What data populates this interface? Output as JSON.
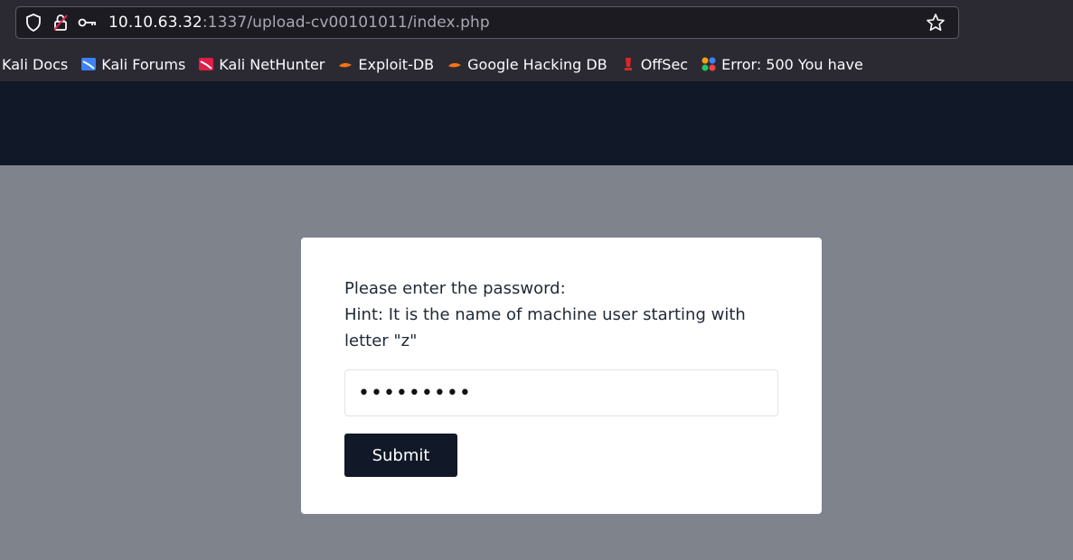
{
  "browser": {
    "url_host": "10.10.63.32",
    "url_path": ":1337/upload-cv00101011/index.php",
    "bookmarks": [
      {
        "label": "Kali Docs",
        "icon": "kali-docs-icon"
      },
      {
        "label": "Kali Forums",
        "icon": "kali-forums-icon"
      },
      {
        "label": "Kali NetHunter",
        "icon": "kali-nethunter-icon"
      },
      {
        "label": "Exploit-DB",
        "icon": "exploit-db-icon"
      },
      {
        "label": "Google Hacking DB",
        "icon": "ghdb-icon"
      },
      {
        "label": "OffSec",
        "icon": "offsec-icon"
      },
      {
        "label": "Error: 500 You have",
        "icon": "joomla-icon"
      }
    ]
  },
  "form": {
    "prompt_line1": "Please enter the password:",
    "prompt_line2": "Hint: It is the name of machine user starting with letter \"z\"",
    "password_value": "•••••••••",
    "submit_label": "Submit"
  },
  "colors": {
    "header_bg": "#111827",
    "body_bg": "#7f838c",
    "button_bg": "#111827",
    "card_bg": "#ffffff"
  }
}
